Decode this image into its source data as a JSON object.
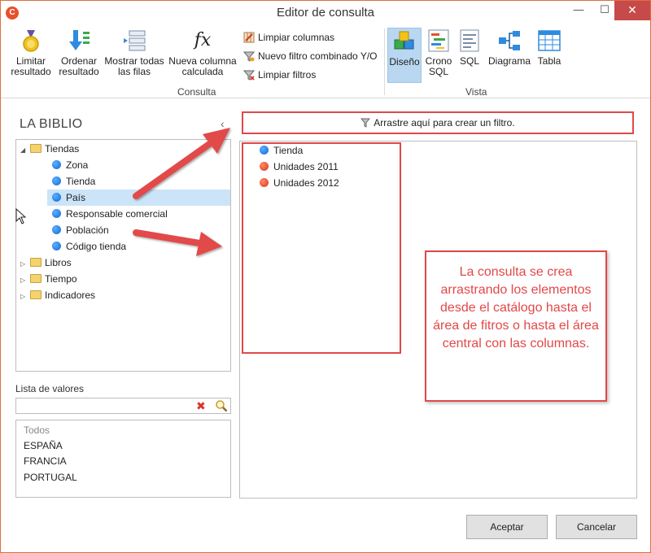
{
  "window": {
    "title": "Editor de consulta",
    "app_icon_letter": "C",
    "minimize_glyph": "—",
    "maximize_glyph": "☐",
    "close_glyph": "✕"
  },
  "ribbon": {
    "consulta_group": {
      "label": "Consulta",
      "buttons": [
        {
          "label_line1": "Limitar",
          "label_line2": "resultado",
          "icon": "medal-icon"
        },
        {
          "label_line1": "Ordenar",
          "label_line2": "resultado",
          "icon": "sort-arrow-icon"
        },
        {
          "label_line1": "Mostrar todas",
          "label_line2": "las filas",
          "icon": "show-rows-icon"
        },
        {
          "label_line1": "Nueva columna",
          "label_line2": "calculada",
          "icon": "function-icon"
        }
      ],
      "function_glyph": "fx",
      "small_commands": [
        {
          "label": "Limpiar columnas",
          "icon": "clear-columns-icon"
        },
        {
          "label": "Nuevo filtro combinado Y/O",
          "icon": "funnel-icon"
        },
        {
          "label": "Limpiar filtros",
          "icon": "clear-filter-icon"
        }
      ]
    },
    "vista_group": {
      "label": "Vista",
      "buttons": [
        {
          "label_line1": "Diseño",
          "label_line2": "",
          "icon": "cubes-icon",
          "active": true
        },
        {
          "label_line1": "Crono",
          "label_line2": "SQL",
          "icon": "chrono-sql-icon"
        },
        {
          "label_line1": "SQL",
          "label_line2": "",
          "icon": "sql-icon"
        },
        {
          "label_line1": "Diagrama",
          "label_line2": "",
          "icon": "diagram-icon"
        },
        {
          "label_line1": "Tabla",
          "label_line2": "",
          "icon": "table-icon"
        }
      ]
    }
  },
  "catalog": {
    "title": "LA BIBLIO",
    "collapse_glyph": "‹",
    "tree": [
      {
        "label": "Tiendas",
        "type": "folder",
        "expanded": true,
        "expander": "◢"
      },
      {
        "label": "Zona",
        "type": "field"
      },
      {
        "label": "Tienda",
        "type": "field"
      },
      {
        "label": "País",
        "type": "field",
        "selected": true
      },
      {
        "label": "Responsable comercial",
        "type": "field"
      },
      {
        "label": "Población",
        "type": "field"
      },
      {
        "label": "Código tienda",
        "type": "field"
      },
      {
        "label": "Libros",
        "type": "folder",
        "expander": "▷"
      },
      {
        "label": "Tiempo",
        "type": "folder",
        "expander": "▷"
      },
      {
        "label": "Indicadores",
        "type": "folder",
        "expander": "▷"
      }
    ]
  },
  "values": {
    "label": "Lista de valores",
    "input_value": "",
    "clear_glyph": "✖",
    "items": [
      "Todos",
      "ESPAÑA",
      "FRANCIA",
      "PORTUGAL"
    ]
  },
  "filter_area": {
    "hint": "Arrastre aquí para crear un filtro."
  },
  "columns": [
    {
      "label": "Tienda",
      "color": "blue"
    },
    {
      "label": "Unidades 2011",
      "color": "red"
    },
    {
      "label": "Unidades 2012",
      "color": "red"
    }
  ],
  "callout": {
    "text": "La consulta se crea arrastrando los elementos desde el catálogo hasta el área de fitros o hasta el área central con las columnas."
  },
  "footer": {
    "ok_label": "Aceptar",
    "cancel_label": "Cancelar"
  },
  "colors": {
    "annotation_red": "#e24848",
    "selection_blue": "#cce4f7",
    "active_view": "#b9d7f0"
  }
}
